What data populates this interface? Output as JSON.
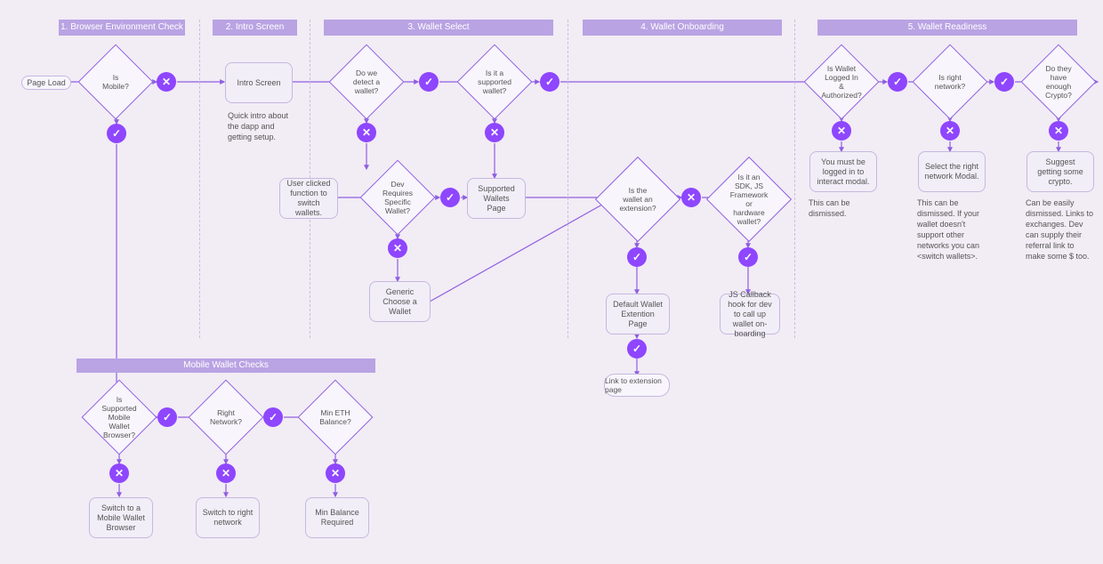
{
  "sections": {
    "s1": "1. Browser Environment Check",
    "s2": "2. Intro Screen",
    "s3": "3. Wallet Select",
    "s4": "4. Wallet Onboarding",
    "s5": "5. Wallet Readiness",
    "mobile": "Mobile Wallet Checks"
  },
  "nodes": {
    "page_load": "Page Load",
    "is_mobile": "Is Mobile?",
    "intro_screen": "Intro Screen",
    "intro_note": "Quick intro about the dapp and getting setup.",
    "detect_wallet": "Do we detect a wallet?",
    "supported_wallet": "Is it a supported wallet?",
    "user_switch": "User clicked function to switch wallets.",
    "dev_specific": "Dev Requires Specific Wallet?",
    "supported_page": "Supported Wallets Page",
    "generic_choose": "Generic Choose a Wallet",
    "is_extension": "Is the wallet an extension?",
    "is_sdk": "Is it an SDK, JS Framework or hardware wallet?",
    "default_ext": "Default Wallet Extention Page",
    "js_callback": "JS Callback hook for dev to call up wallet on-boarding",
    "link_ext": "Link to extension page",
    "logged_in": "Is Wallet Logged In & Authorized?",
    "right_network": "Is right network?",
    "enough_crypto": "Do they have enough Crypto?",
    "must_login": "You must be logged in to interact modal.",
    "must_login_note": "This can be dismissed.",
    "select_network": "Select the right network Modal.",
    "select_network_note": "This can be dismissed. If your wallet doesn't support other networks you can <switch wallets>.",
    "suggest_crypto": "Suggest getting some crypto.",
    "suggest_crypto_note": "Can be easily dismissed. Links to exchanges. Dev can supply their referral link to make some $ too.",
    "m_supported": "Is Supported Mobile Wallet Browser?",
    "m_network": "Right Network?",
    "m_balance": "Min ETH Balance?",
    "m_switch_browser": "Switch to a Mobile Wallet Browser",
    "m_switch_network": "Switch to right network",
    "m_min_balance": "Min Balance Required"
  }
}
